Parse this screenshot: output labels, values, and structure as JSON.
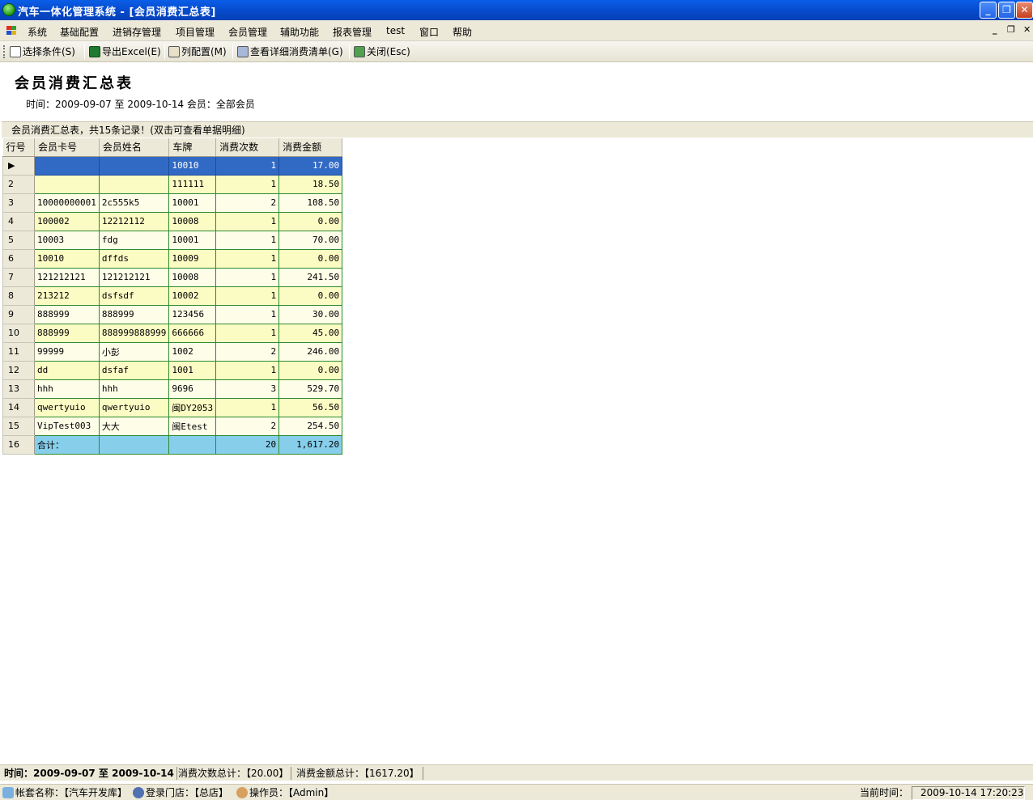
{
  "window": {
    "title": "汽车一体化管理系统 - [会员消费汇总表]",
    "min_glyph": "_",
    "restore_glyph": "❐",
    "close_glyph": "✕"
  },
  "menu": {
    "items": [
      "系统",
      "基础配置",
      "进销存管理",
      "项目管理",
      "会员管理",
      "辅助功能",
      "报表管理",
      "test",
      "窗口",
      "帮助"
    ],
    "mdi_min": "_",
    "mdi_restore": "❐",
    "mdi_close": "✕"
  },
  "toolbar": {
    "select_condition": "选择条件(S)",
    "export_excel": "导出Excel(E)",
    "column_config": "列配置(M)",
    "view_detail": "查看详细消费清单(G)",
    "close": "关闭(Esc)"
  },
  "report": {
    "title": "会员消费汇总表",
    "subtitle": "时间：2009-09-07 至 2009-10-14    会员：全部会员"
  },
  "grid": {
    "caption": "会员消费汇总表，共15条记录！(双击可查看单据明细)",
    "columns": [
      "行号",
      "会员卡号",
      "会员姓名",
      "车牌",
      "消费次数",
      "消费金额"
    ],
    "rows": [
      {
        "no": "▶",
        "card": "",
        "name": "",
        "plate": "10010",
        "count": "1",
        "amount": "17.00"
      },
      {
        "no": "2",
        "card": "",
        "name": "",
        "plate": "111111",
        "count": "1",
        "amount": "18.50"
      },
      {
        "no": "3",
        "card": "10000000001",
        "name": "2c555k5",
        "plate": "10001",
        "count": "2",
        "amount": "108.50"
      },
      {
        "no": "4",
        "card": "100002",
        "name": "12212112",
        "plate": "10008",
        "count": "1",
        "amount": "0.00"
      },
      {
        "no": "5",
        "card": "10003",
        "name": "fdg",
        "plate": "10001",
        "count": "1",
        "amount": "70.00"
      },
      {
        "no": "6",
        "card": "10010",
        "name": "dffds",
        "plate": "10009",
        "count": "1",
        "amount": "0.00"
      },
      {
        "no": "7",
        "card": "121212121",
        "name": "121212121",
        "plate": "10008",
        "count": "1",
        "amount": "241.50"
      },
      {
        "no": "8",
        "card": "213212",
        "name": "dsfsdf",
        "plate": "10002",
        "count": "1",
        "amount": "0.00"
      },
      {
        "no": "9",
        "card": "888999",
        "name": "888999",
        "plate": "123456",
        "count": "1",
        "amount": "30.00"
      },
      {
        "no": "10",
        "card": "888999",
        "name": "888999888999",
        "plate": "666666",
        "count": "1",
        "amount": "45.00"
      },
      {
        "no": "11",
        "card": "99999",
        "name": "小彭",
        "plate": "1002",
        "count": "2",
        "amount": "246.00"
      },
      {
        "no": "12",
        "card": "dd",
        "name": "dsfaf",
        "plate": "1001",
        "count": "1",
        "amount": "0.00"
      },
      {
        "no": "13",
        "card": "hhh",
        "name": "hhh",
        "plate": "9696",
        "count": "3",
        "amount": "529.70"
      },
      {
        "no": "14",
        "card": "qwertyuio",
        "name": "qwertyuio",
        "plate": "闽DY2053",
        "count": "1",
        "amount": "56.50"
      },
      {
        "no": "15",
        "card": "VipTest003",
        "name": "大大",
        "plate": "闽Etest",
        "count": "2",
        "amount": "254.50"
      }
    ],
    "total": {
      "no": "16",
      "label": "合计：",
      "count": "20",
      "amount": "1,617.20"
    }
  },
  "status1": {
    "period": "时间：2009-09-07 至 2009-10-14",
    "count_total": "消费次数总计：【20.00】",
    "amount_total": "消费金额总计：【1617.20】"
  },
  "status2": {
    "account": "帐套名称：【汽车开发库】",
    "store": "登录门店：【总店】",
    "operator": "操作员：【Admin】",
    "time_label": "当前时间：",
    "time_value": "2009-10-14 17:20:23"
  }
}
